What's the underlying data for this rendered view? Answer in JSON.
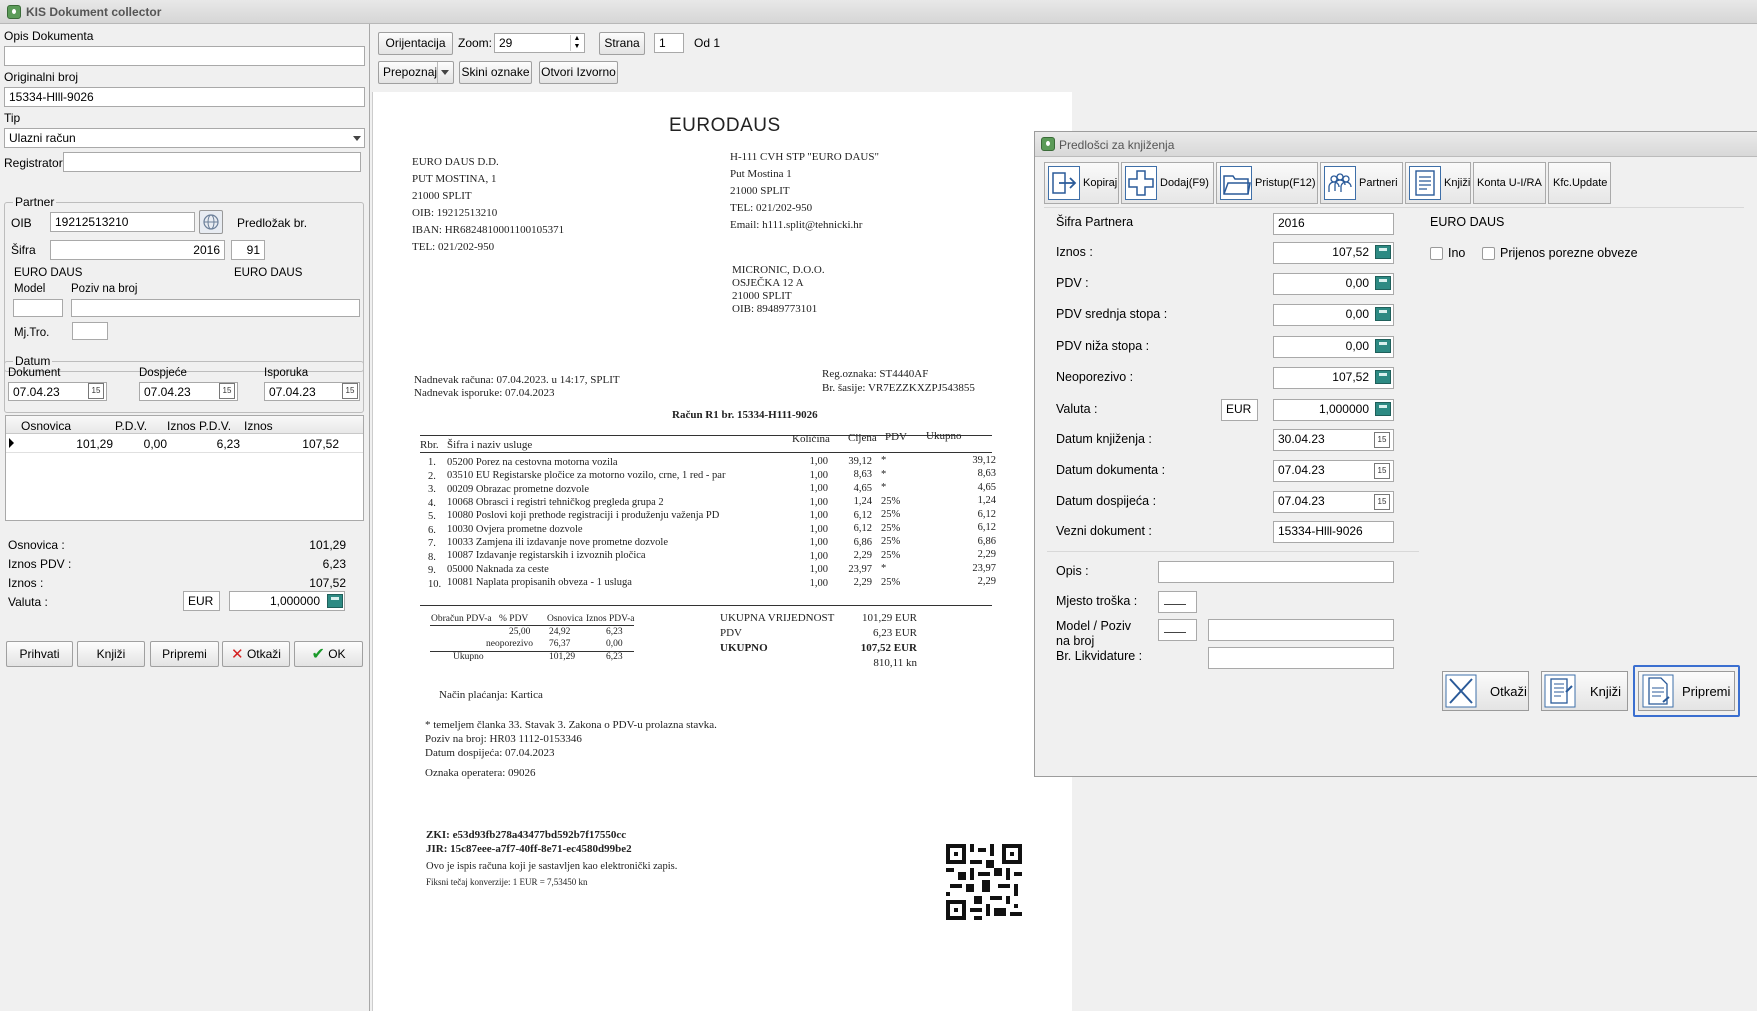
{
  "app": {
    "title": "KIS Dokument collector"
  },
  "left": {
    "opis_label": "Opis Dokumenta",
    "opis_value": "",
    "orig_label": "Originalni broj",
    "orig_value": "15334-Hlll-9026",
    "tip_label": "Tip",
    "tip_value": "Ulazni račun",
    "registrator_label": "Registrator",
    "registrator_value": "",
    "partner_group": "Partner",
    "oib_label": "OIB",
    "oib_value": "19212513210",
    "predlozak_label": "Predložak br.",
    "sifra_label": "Šifra",
    "sifra_value": "2016",
    "predlozak_value": "91",
    "partner_name1": "EURO DAUS",
    "partner_name2": "EURO DAUS",
    "model_label": "Model",
    "poziv_label": "Poziv na broj",
    "mjtro_label": "Mj.Tro.",
    "datum_group": "Datum",
    "dokument_label": "Dokument",
    "dospjece_label": "Dospjeće",
    "isporuka_label": "Isporuka",
    "dokument_value": "07.04.23",
    "dospjece_value": "07.04.23",
    "isporuka_value": "07.04.23",
    "grid_headers": [
      "Osnovica",
      "P.D.V.",
      "Iznos P.D.V.",
      "Iznos"
    ],
    "grid_row": [
      "101,29",
      "0,00",
      "6,23",
      "107,52"
    ],
    "osnovica_label": "Osnovica :",
    "osnovica_value": "101,29",
    "iznospdv_label": "Iznos PDV :",
    "iznospdv_value": "6,23",
    "iznos_label": "Iznos :",
    "iznos_value": "107,52",
    "valuta_label": "Valuta :",
    "valuta_code": "EUR",
    "valuta_rate": "1,000000",
    "buttons": {
      "prihvati": "Prihvati",
      "knjizi": "Knjiži",
      "pripremi": "Pripremi",
      "otkazi": "Otkaži",
      "ok": "OK"
    }
  },
  "toolbar": {
    "orijentacija": "Orijentacija",
    "zoom_label": "Zoom:",
    "zoom_value": "29",
    "strana": "Strana",
    "page_value": "1",
    "od": "Od 1",
    "prepoznaj": "Prepoznaj",
    "skini": "Skini oznake",
    "otvori": "Otvori Izvorno"
  },
  "invoice": {
    "logo": "EURODAUS",
    "seller": [
      "EURO DAUS D.D.",
      "PUT MOSTINA, 1",
      "21000 SPLIT",
      "OIB: 19212513210",
      "IBAN: HR6824810001100105371",
      "TEL: 021/202-950"
    ],
    "branch": [
      "H-111 CVH STP \"EURO DAUS\"",
      "Put Mostina 1",
      "21000 SPLIT",
      "TEL: 021/202-950",
      "Email: h111.split@tehnicki.hr"
    ],
    "buyer": [
      "MICRONIC, D.O.O.",
      "OSJEČKA 12 A",
      "21000 SPLIT",
      "OIB: 89489773101"
    ],
    "dates": [
      "Nadnevak računa: 07.04.2023. u 14:17, SPLIT",
      "Nadnevak isporuke: 07.04.2023"
    ],
    "vehicle": [
      "Reg.oznaka: ST4440AF",
      "Br. šasije: VR7EZZKXZPJ543855"
    ],
    "heading": "Račun R1 br. 15334-H111-9026",
    "table_headers": [
      "Rbr.",
      "Šifra i naziv usluge",
      "Količina",
      "Cijena",
      "PDV",
      "Ukupno"
    ],
    "items": [
      [
        "1.",
        "05200 Porez na cestovna motorna vozila",
        "1,00",
        "39,12",
        "*",
        "39,12"
      ],
      [
        "2.",
        "03510 EU Registarske pločice za motorno vozilo, crne, 1 red - par",
        "1,00",
        "8,63",
        "*",
        "8,63"
      ],
      [
        "3.",
        "00209 Obrazac prometne dozvole",
        "1,00",
        "4,65",
        "*",
        "4,65"
      ],
      [
        "4.",
        "10068 Obrasci i registri tehničkog pregleda grupa 2",
        "1,00",
        "1,24",
        "25%",
        "1,24"
      ],
      [
        "5.",
        "10080 Poslovi koji prethode registraciji i produženju važenja PD",
        "1,00",
        "6,12",
        "25%",
        "6,12"
      ],
      [
        "6.",
        "10030 Ovjera prometne dozvole",
        "1,00",
        "6,12",
        "25%",
        "6,12"
      ],
      [
        "7.",
        "10033 Zamjena ili izdavanje nove prometne dozvole",
        "1,00",
        "6,86",
        "25%",
        "6,86"
      ],
      [
        "8.",
        "10087 Izdavanje registarskih i izvoznih pločica",
        "1,00",
        "2,29",
        "25%",
        "2,29"
      ],
      [
        "9.",
        "05000 Naknada za ceste",
        "1,00",
        "23,97",
        "*",
        "23,97"
      ],
      [
        "10.",
        "10081 Naplata propisanih obveza - 1 usluga",
        "1,00",
        "2,29",
        "25%",
        "2,29"
      ]
    ],
    "pdv_table_headers": [
      "Obračun PDV-a",
      "% PDV",
      "Osnovica",
      "Iznos PDV-a"
    ],
    "pdv_rows": [
      [
        "",
        "25,00",
        "24,92",
        "6,23"
      ],
      [
        "",
        "neoporezivo",
        "76,37",
        "0,00"
      ],
      [
        "Ukupno",
        "",
        "101,29",
        "6,23"
      ]
    ],
    "totals_labels": [
      "UKUPNA VRIJEDNOST",
      "PDV",
      "UKUPNO"
    ],
    "totals_values": [
      "101,29 EUR",
      "6,23 EUR",
      "107,52 EUR",
      "810,11 kn"
    ],
    "payment": "Način plaćanja: Kartica",
    "notes": [
      "* temeljem članka 33. Stavak 3. Zakona o PDV-u prolazna stavka.",
      "Poziv na broj: HR03 1112-0153346",
      "Datum dospijeća: 07.04.2023"
    ],
    "operator": "Oznaka operatera: 09026",
    "zki": "ZKI: e53d93fb278a43477bd592b7f17550cc",
    "jir": "JIR: 15c87eee-a7f7-40ff-8e71-ec4580d99be2",
    "footer1": "Ovo je ispis računa koji je sastavljen kao elektronički zapis.",
    "footer2": "Fiksni tečaj konverzije: 1 EUR = 7,53450 kn"
  },
  "dialog": {
    "title": "Predlošci za knjiženja",
    "toolbar": [
      "Kopiraj",
      "Dodaj(F9)",
      "Pristup(F12)",
      "Partneri",
      "Knjiži",
      "Konta U-I/RA",
      "Kfc.Update"
    ],
    "sifra_label": "Šifra Partnera",
    "sifra_value": "2016",
    "partner_name": "EURO DAUS",
    "iznos_label": "Iznos :",
    "iznos_value": "107,52",
    "ino_label": "Ino",
    "prijenos_label": "Prijenos porezne obveze",
    "pdv_label": "PDV :",
    "pdv_value": "0,00",
    "pdv_srednja_label": "PDV srednja stopa :",
    "pdv_srednja_value": "0,00",
    "pdv_niza_label": "PDV niža stopa :",
    "pdv_niza_value": "0,00",
    "neoporezivo_label": "Neoporezivo :",
    "neoporezivo_value": "107,52",
    "valuta_label": "Valuta :",
    "valuta_code": "EUR",
    "valuta_rate": "1,000000",
    "datum_knjizenja_label": "Datum knjiženja :",
    "datum_knjizenja_value": "30.04.23",
    "datum_dokumenta_label": "Datum dokumenta :",
    "datum_dokumenta_value": "07.04.23",
    "datum_dospijeca_label": "Datum dospijeća :",
    "datum_dospijeca_value": "07.04.23",
    "vezni_label": "Vezni dokument :",
    "vezni_value": "15334-Hlll-9026",
    "opis_label": "Opis :",
    "mjesto_label": "Mjesto troška :",
    "model_label_1": "Model / Poziv",
    "model_label_2": "na broj",
    "likvidature_label": "Br. Likvidature :",
    "btn_otkazi": "Otkaži",
    "btn_knjizi": "Knjiži",
    "btn_pripremi": "Pripremi"
  },
  "colors": {
    "accent": "#3b6fd0",
    "calc": "#2d8a83",
    "ok_green": "#1a9a2a",
    "cancel_red": "#d42020"
  }
}
